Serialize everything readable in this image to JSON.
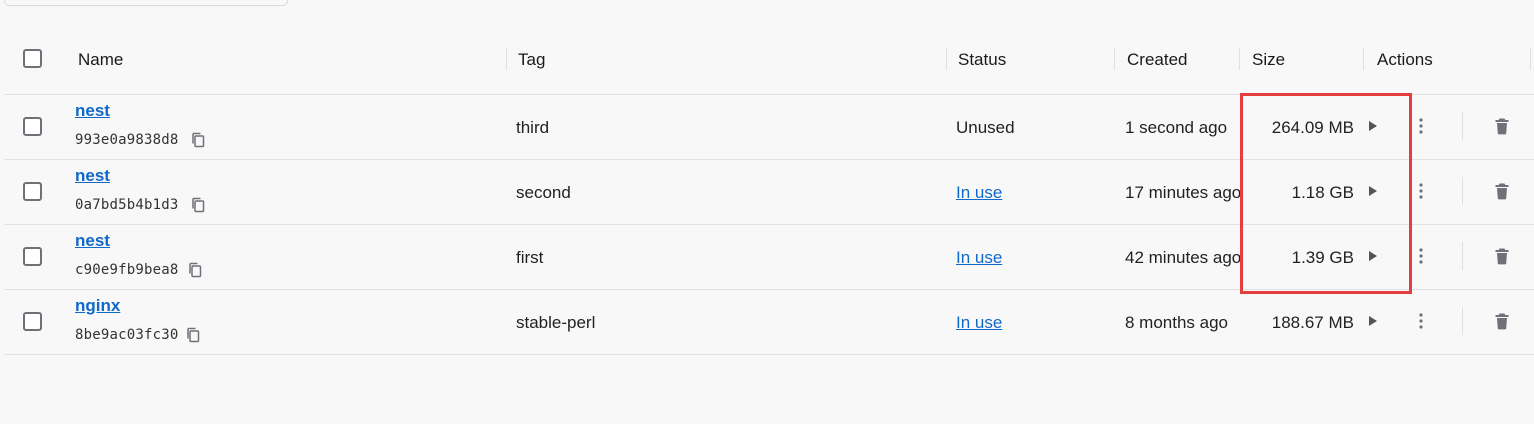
{
  "columns": {
    "name": "Name",
    "tag": "Tag",
    "status": "Status",
    "created": "Created",
    "size": "Size",
    "actions": "Actions"
  },
  "rows": [
    {
      "name": "nest",
      "id": "993e0a9838d8",
      "tag": "third",
      "status": "Unused",
      "status_in_use": false,
      "created": "1 second ago",
      "size": "264.09 MB"
    },
    {
      "name": "nest",
      "id": "0a7bd5b4b1d3",
      "tag": "second",
      "status": "In use",
      "status_in_use": true,
      "created": "17 minutes ago",
      "size": "1.18 GB"
    },
    {
      "name": "nest",
      "id": "c90e9fb9bea8",
      "tag": "first",
      "status": "In use",
      "status_in_use": true,
      "created": "42 minutes ago",
      "size": "1.39 GB"
    },
    {
      "name": "nginx",
      "id": "8be9ac03fc30",
      "tag": "stable-perl",
      "status": "In use",
      "status_in_use": true,
      "created": "8 months ago",
      "size": "188.67 MB"
    }
  ],
  "icons": {
    "copy": "copy-icon",
    "run": "play-icon",
    "more": "more-vertical-icon",
    "delete": "trash-icon"
  },
  "colors": {
    "link": "#1069c9",
    "highlight": "#e43d3d",
    "icon": "#6e7178"
  }
}
